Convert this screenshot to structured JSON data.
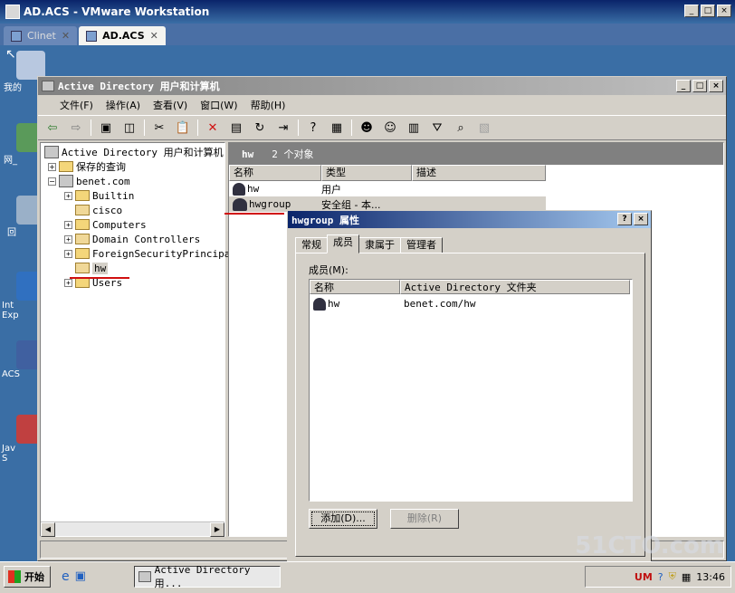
{
  "vmware": {
    "title": "AD.ACS - VMware Workstation",
    "tabs": [
      {
        "label": "Clinet",
        "active": false
      },
      {
        "label": "AD.ACS",
        "active": true
      }
    ],
    "close_glyph": "✕"
  },
  "desktop": {
    "icons": [
      "我的",
      "网_",
      "回",
      "Int\nExp",
      "ACS",
      "Jav\nS"
    ]
  },
  "mmc": {
    "title": "Active Directory 用户和计算机",
    "menu": [
      "文件(F)",
      "操作(A)",
      "查看(V)",
      "窗口(W)",
      "帮助(H)"
    ],
    "tree": {
      "root": "Active Directory 用户和计算机",
      "saved_queries": "保存的查询",
      "domain": "benet.com",
      "children": [
        "Builtin",
        "cisco",
        "Computers",
        "Domain Controllers",
        "ForeignSecurityPrincipal",
        "hw",
        "Users"
      ]
    },
    "list": {
      "header_name": "hw",
      "header_count": "2 个对象",
      "columns": [
        "名称",
        "类型",
        "描述"
      ],
      "rows": [
        {
          "name": "hw",
          "type": "用户"
        },
        {
          "name": "hwgroup",
          "type": "安全组 - 本..."
        }
      ]
    }
  },
  "dialog": {
    "title": "hwgroup 属性",
    "tabs": [
      "常规",
      "成员",
      "隶属于",
      "管理者"
    ],
    "selected_tab": "成员",
    "members_label": "成员(M):",
    "columns": [
      "名称",
      "Active Directory 文件夹"
    ],
    "rows": [
      {
        "name": "hw",
        "folder": "benet.com/hw"
      }
    ],
    "add_button": "添加(D)...",
    "remove_button": "删除(R)"
  },
  "taskbar": {
    "start": "开始",
    "task": "Active Directory 用...",
    "clock": "13:46"
  },
  "watermark": "51CTO.com"
}
